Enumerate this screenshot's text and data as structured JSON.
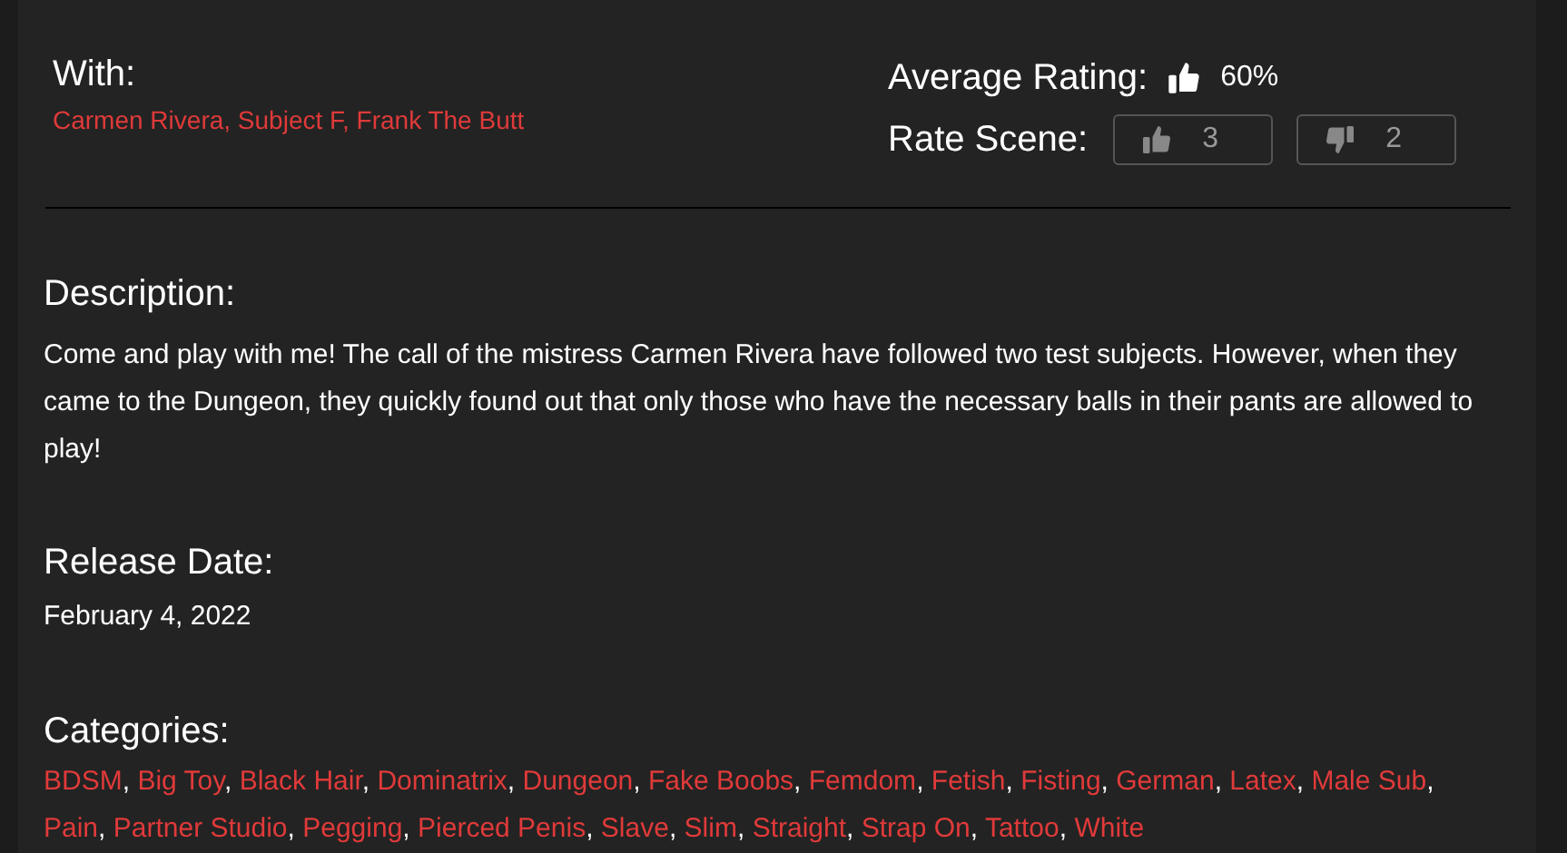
{
  "with": {
    "heading": "With:",
    "separator": ", ",
    "performers": [
      "Carmen Rivera",
      "Subject F",
      "Frank The Butt"
    ]
  },
  "rating": {
    "average_label": "Average Rating:",
    "average": "60%",
    "rate_label": "Rate Scene:",
    "likes": "3",
    "dislikes": "2"
  },
  "description": {
    "heading": "Description:",
    "text": "Come and play with me! The call of the mistress Carmen Rivera have followed two test subjects. However, when they came to the Dungeon, they quickly found out that only those who have the necessary balls in their pants are allowed to play!"
  },
  "release": {
    "heading": "Release Date:",
    "date": "February 4, 2022"
  },
  "categories": {
    "heading": "Categories:",
    "separator": ",",
    "items": [
      "BDSM",
      "Big Toy",
      "Black Hair",
      "Dominatrix",
      "Dungeon",
      "Fake Boobs",
      "Femdom",
      "Fetish",
      "Fisting",
      "German",
      "Latex",
      "Male Sub",
      "Pain",
      "Partner Studio",
      "Pegging",
      "Pierced Penis",
      "Slave",
      "Slim",
      "Straight",
      "Strap On",
      "Tattoo",
      "White"
    ]
  }
}
